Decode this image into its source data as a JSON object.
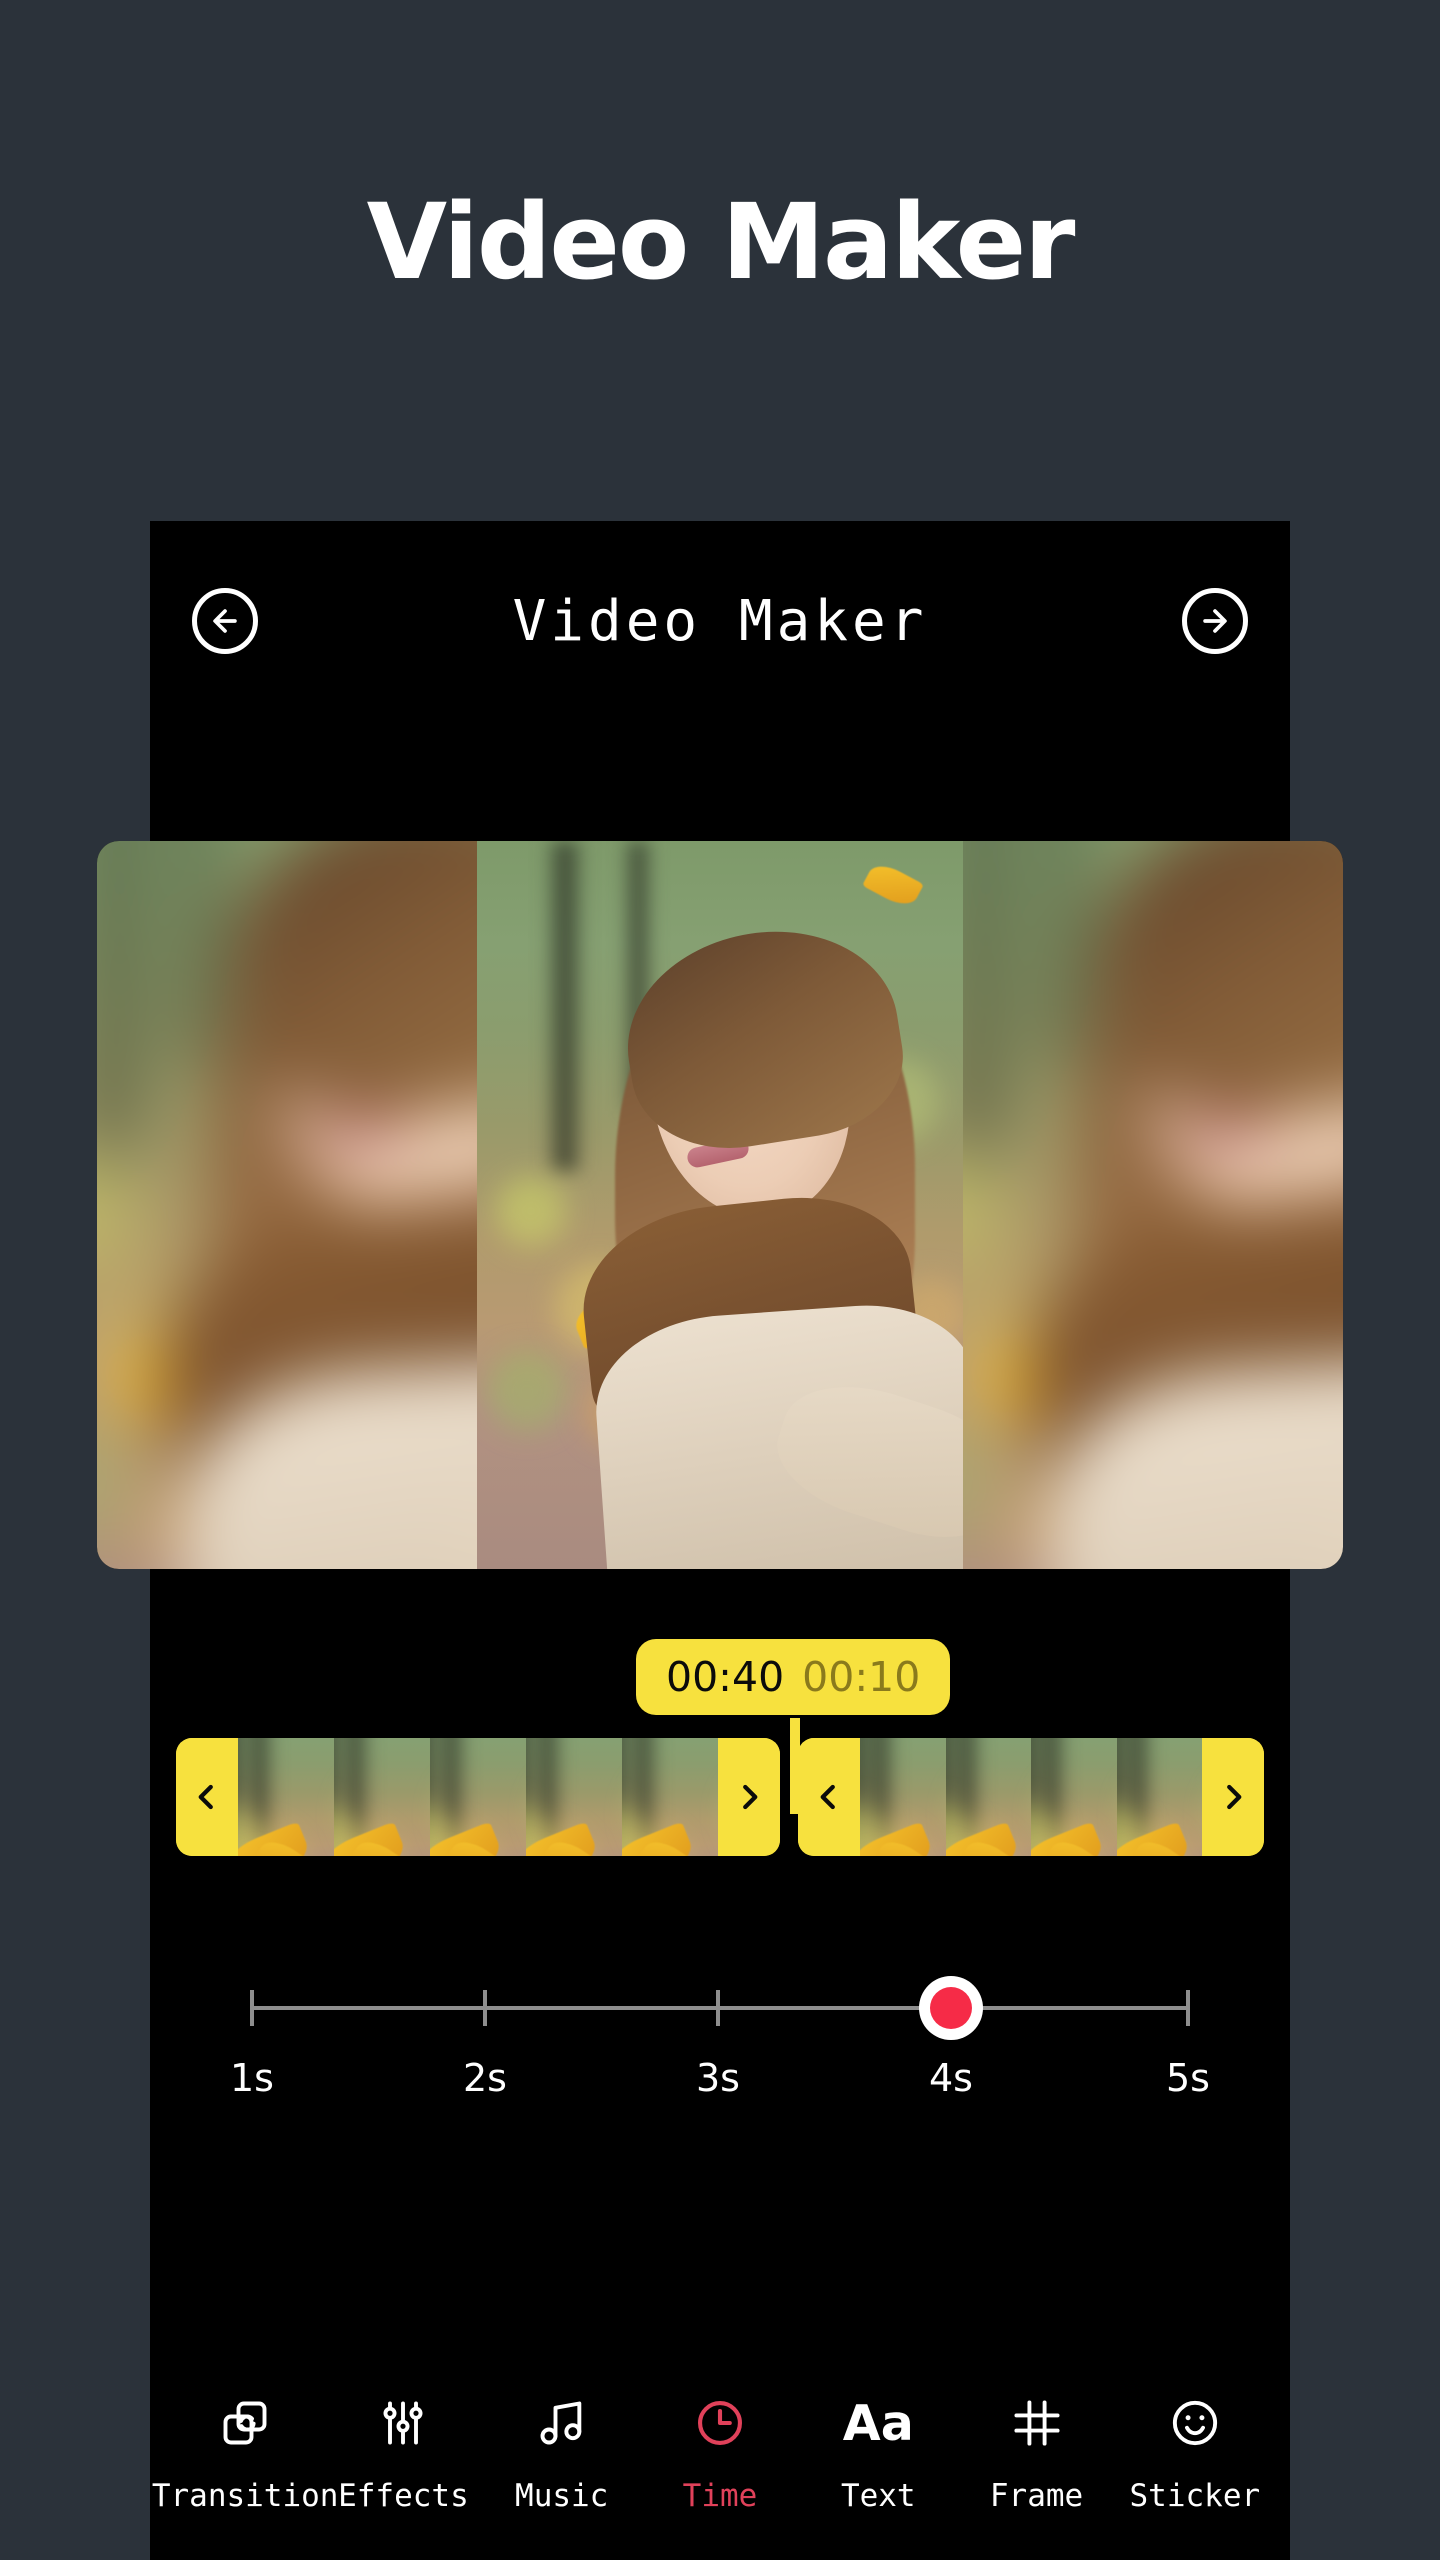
{
  "hero": {
    "title": "Video Maker"
  },
  "colors": {
    "page_bg": "#2b323a",
    "frame_bg": "#000000",
    "accent_yellow": "#f7e13e",
    "accent_red": "#e0415a",
    "thumb_red": "#f62b47",
    "text_white": "#ffffff",
    "badge_secondary": "#8a7a1c"
  },
  "app_header": {
    "title": "Video Maker",
    "back_icon": "arrow-left-circle-icon",
    "forward_icon": "arrow-right-circle-icon"
  },
  "preview": {
    "description": "Woman with long brown hair, eyes closed, wearing brown scarf and beige coat in an autumn park with falling yellow leaves"
  },
  "timeline": {
    "badge": {
      "primary_time": "00:40",
      "secondary_time": "00:10"
    },
    "clips": [
      {
        "id": "clip-1",
        "left_handle_icon": "chevron-left-icon",
        "right_handle_icon": "chevron-right-icon",
        "frame_count": 5
      },
      {
        "id": "clip-2",
        "left_handle_icon": "chevron-left-icon",
        "right_handle_icon": "chevron-right-icon",
        "frame_count": 4
      }
    ]
  },
  "duration_slider": {
    "ticks": [
      "1s",
      "2s",
      "3s",
      "4s",
      "5s"
    ],
    "selected_value": "4s",
    "min": 1,
    "max": 5,
    "current": 4
  },
  "toolbar": {
    "items": [
      {
        "label": "Transition",
        "icon": "transition-icon",
        "active": false
      },
      {
        "label": "Effects",
        "icon": "sliders-icon",
        "active": false
      },
      {
        "label": "Music",
        "icon": "music-note-icon",
        "active": false
      },
      {
        "label": "Time",
        "icon": "clock-icon",
        "active": true
      },
      {
        "label": "Text",
        "icon": "text-aa-icon",
        "active": false
      },
      {
        "label": "Frame",
        "icon": "frame-icon",
        "active": false
      },
      {
        "label": "Sticker",
        "icon": "smiley-icon",
        "active": false
      }
    ]
  }
}
